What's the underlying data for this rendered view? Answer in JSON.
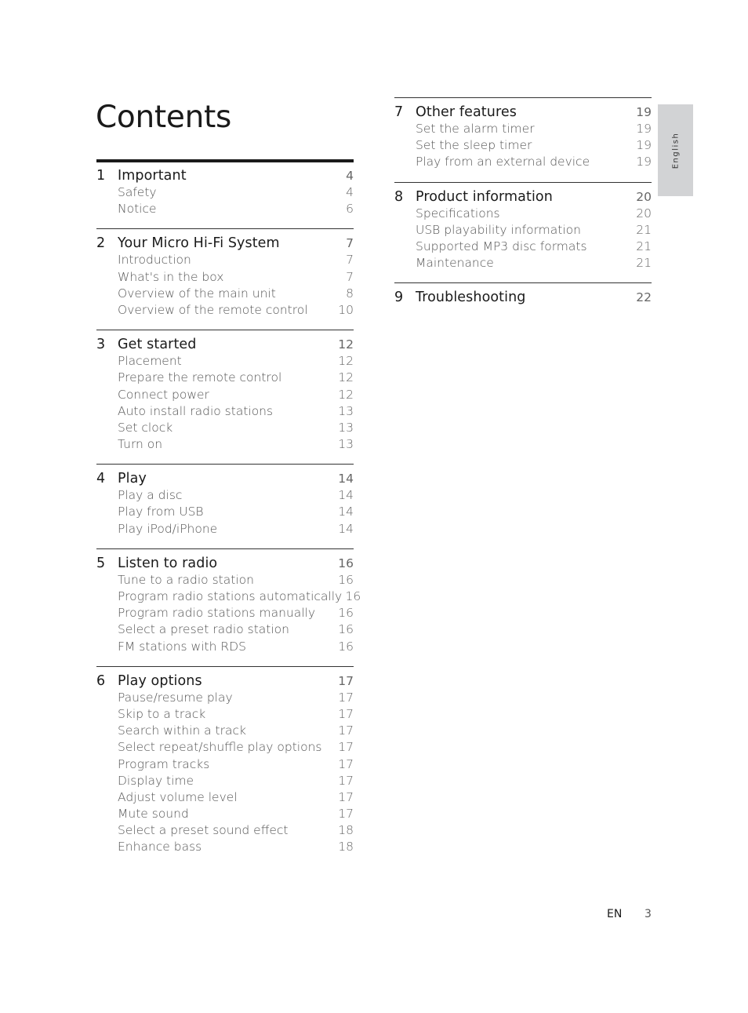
{
  "title": "Contents",
  "language_tab": "English",
  "footer": {
    "lang": "EN",
    "page": "3"
  },
  "sections": [
    {
      "num": "1",
      "title": "Important",
      "page": "4",
      "items": [
        {
          "label": "Safety",
          "page": "4"
        },
        {
          "label": "Notice",
          "page": "6"
        }
      ]
    },
    {
      "num": "2",
      "title": "Your Micro Hi-Fi System",
      "page": "7",
      "items": [
        {
          "label": "Introduction",
          "page": "7"
        },
        {
          "label": "What's in the box",
          "page": "7"
        },
        {
          "label": "Overview of the main unit",
          "page": "8"
        },
        {
          "label": "Overview of the remote control",
          "page": "10"
        }
      ]
    },
    {
      "num": "3",
      "title": "Get started",
      "page": "12",
      "items": [
        {
          "label": "Placement",
          "page": "12"
        },
        {
          "label": "Prepare the remote control",
          "page": "12"
        },
        {
          "label": "Connect power",
          "page": "12"
        },
        {
          "label": "Auto install radio stations",
          "page": "13"
        },
        {
          "label": "Set clock",
          "page": "13"
        },
        {
          "label": "Turn on",
          "page": "13"
        }
      ]
    },
    {
      "num": "4",
      "title": "Play",
      "page": "14",
      "items": [
        {
          "label": "Play a disc",
          "page": "14"
        },
        {
          "label": "Play from USB",
          "page": "14"
        },
        {
          "label": "Play iPod/iPhone",
          "page": "14"
        }
      ]
    },
    {
      "num": "5",
      "title": "Listen to radio",
      "page": "16",
      "items": [
        {
          "label": "Tune to a radio station",
          "page": "16"
        },
        {
          "label": "Program radio stations automatically",
          "page": "16"
        },
        {
          "label": "Program radio stations manually",
          "page": "16"
        },
        {
          "label": "Select a preset radio station",
          "page": "16"
        },
        {
          "label": "FM stations with RDS",
          "page": "16"
        }
      ]
    },
    {
      "num": "6",
      "title": "Play options",
      "page": "17",
      "items": [
        {
          "label": "Pause/resume play",
          "page": "17"
        },
        {
          "label": "Skip to a track",
          "page": "17"
        },
        {
          "label": "Search within a track",
          "page": "17"
        },
        {
          "label": "Select repeat/shuffle play options",
          "page": "17"
        },
        {
          "label": "Program tracks",
          "page": "17"
        },
        {
          "label": "Display time",
          "page": "17"
        },
        {
          "label": "Adjust volume level",
          "page": "17"
        },
        {
          "label": "Mute sound",
          "page": "17"
        },
        {
          "label": "Select a preset sound effect",
          "page": "18"
        },
        {
          "label": "Enhance bass",
          "page": "18"
        }
      ]
    },
    {
      "num": "7",
      "title": "Other features",
      "page": "19",
      "items": [
        {
          "label": "Set the alarm timer",
          "page": "19"
        },
        {
          "label": "Set the sleep timer",
          "page": "19"
        },
        {
          "label": "Play from an external device",
          "page": "19"
        }
      ]
    },
    {
      "num": "8",
      "title": "Product information",
      "page": "20",
      "items": [
        {
          "label": "Specifications",
          "page": "20"
        },
        {
          "label": "USB playability information",
          "page": "21"
        },
        {
          "label": "Supported MP3 disc formats",
          "page": "21"
        },
        {
          "label": "Maintenance",
          "page": "21"
        }
      ]
    },
    {
      "num": "9",
      "title": "Troubleshooting",
      "page": "22",
      "items": []
    }
  ]
}
